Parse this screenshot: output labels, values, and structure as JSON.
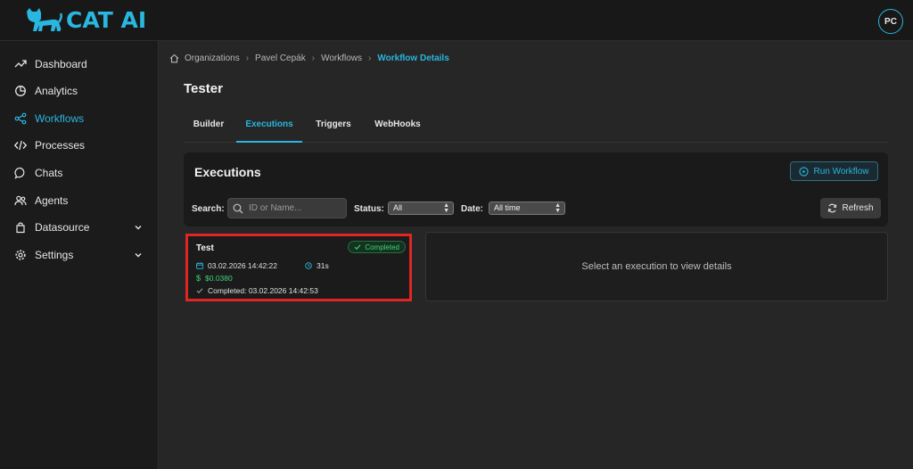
{
  "app": {
    "name": "CAT AI",
    "user_initials": "PC"
  },
  "sidebar": {
    "items": [
      {
        "label": "Dashboard",
        "icon": "trend-icon"
      },
      {
        "label": "Analytics",
        "icon": "pie-chart-icon"
      },
      {
        "label": "Workflows",
        "icon": "share-nodes-icon",
        "active": true
      },
      {
        "label": "Processes",
        "icon": "code-icon"
      },
      {
        "label": "Chats",
        "icon": "chat-bubble-icon"
      },
      {
        "label": "Agents",
        "icon": "users-icon"
      },
      {
        "label": "Datasource",
        "icon": "database-icon",
        "expandable": true
      },
      {
        "label": "Settings",
        "icon": "gear-icon",
        "expandable": true
      }
    ]
  },
  "breadcrumb": [
    "Organizations",
    "Pavel Cepák",
    "Workflows",
    "Workflow Details"
  ],
  "page": {
    "title": "Tester"
  },
  "tabs": [
    "Builder",
    "Executions",
    "Triggers",
    "WebHooks"
  ],
  "active_tab": "Executions",
  "executions": {
    "title": "Executions",
    "run_button": "Run Workflow",
    "search_label": "Search:",
    "search_placeholder": "ID or Name...",
    "status_label": "Status:",
    "status_value": "All",
    "date_label": "Date:",
    "date_value": "All time",
    "refresh_button": "Refresh",
    "items": [
      {
        "name": "Test",
        "status": "Completed",
        "started": "03.02.2026 14:42:22",
        "duration": "31s",
        "cost": "$0.0380",
        "completed": "Completed: 03.02.2026 14:42:53"
      }
    ],
    "empty_details": "Select an execution to view details"
  },
  "colors": {
    "accent": "#29b6e0",
    "success": "#44d27a",
    "highlight": "#e02525"
  }
}
